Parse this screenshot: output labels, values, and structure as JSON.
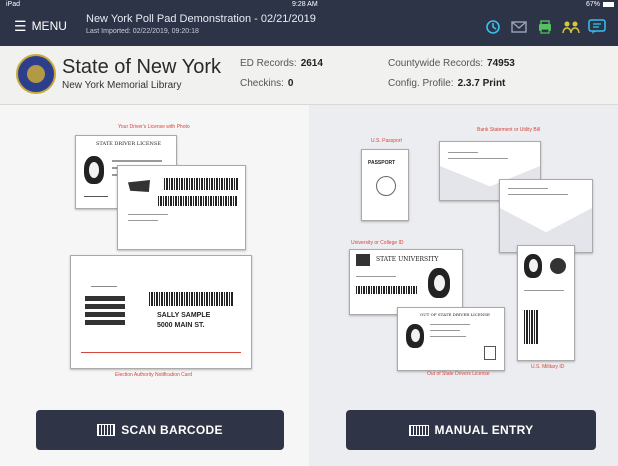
{
  "status_bar": {
    "device": "iPad",
    "time": "9:28 AM",
    "battery": "67%"
  },
  "header": {
    "menu_label": "MENU",
    "title": "New York Poll Pad Demonstration - 02/21/2019",
    "last_imported": "Last Imported: 02/22/2019, 09:20:18",
    "icons": [
      "history-icon",
      "mail-icon",
      "printer-icon",
      "users-icon",
      "chat-icon"
    ]
  },
  "info": {
    "state": "State of New York",
    "library": "New York Memorial Library",
    "ed_records_label": "ED Records:",
    "ed_records_value": "2614",
    "checkins_label": "Checkins:",
    "checkins_value": "0",
    "county_label": "Countywide Records:",
    "county_value": "74953",
    "profile_label": "Config. Profile:",
    "profile_value": "2.3.7 Print"
  },
  "left_panel": {
    "caption_top": "Your Driver's License with Photo",
    "dl_title": "STATE DRIVER LICENSE",
    "caption_bottom": "Election Authority Notification Card",
    "card_name": "SALLY SAMPLE",
    "card_address": "5000 MAIN ST."
  },
  "right_panel": {
    "caption_passport": "U.S. Passport",
    "passport_text": "PASSPORT",
    "caption_bank": "Bank Statement or Utility Bill",
    "caption_university": "University or College ID",
    "university_text": "STATE UNIVERSITY",
    "caption_out_of_state": "Out of State Drivers License",
    "out_of_state_title": "OUT OF STATE DRIVER LICENSE",
    "caption_military": "U.S. Military ID"
  },
  "buttons": {
    "scan": "SCAN BARCODE",
    "manual": "MANUAL ENTRY"
  }
}
